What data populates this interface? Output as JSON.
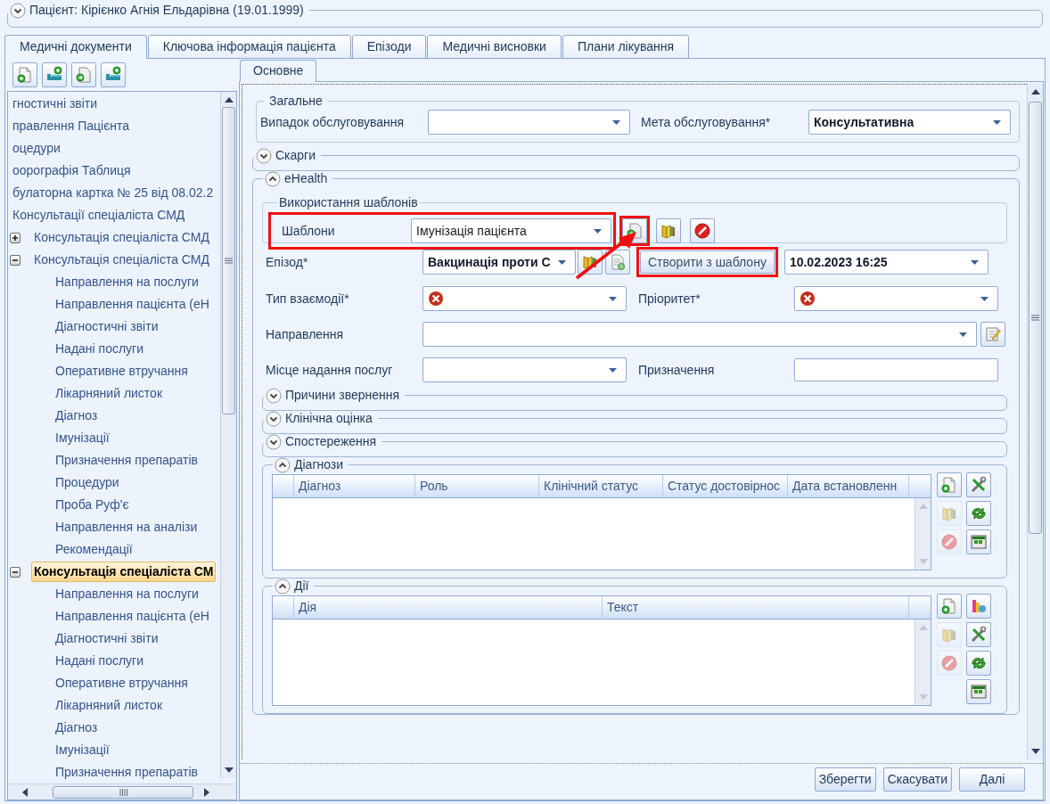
{
  "patient_header": {
    "title": "Пацієнт: Кірієнко Агнія Ельдарівна (19.01.1999)",
    "expanded": false
  },
  "tabs": [
    {
      "label": "Медичні документи",
      "selected": true
    },
    {
      "label": "Ключова інформація пацієнта",
      "selected": false
    },
    {
      "label": "Епізоди",
      "selected": false
    },
    {
      "label": "Медичні висновки",
      "selected": false
    },
    {
      "label": "Плани лікування",
      "selected": false
    }
  ],
  "left_toolbar": [
    {
      "kind": "document-add"
    },
    {
      "kind": "bed-add"
    },
    {
      "kind": "document-import"
    },
    {
      "kind": "bed-add"
    }
  ],
  "tree": [
    {
      "label": "гностичні звіти",
      "selected": false
    },
    {
      "label": "правлення Пацієнта",
      "selected": false
    },
    {
      "label": "оцедури",
      "selected": false
    },
    {
      "label": "оорографія Таблиця",
      "selected": false
    },
    {
      "label": "булаторна картка № 25 від 08.02.2",
      "selected": false
    },
    {
      "label": "Консультації спеціаліста СМД",
      "selected": false,
      "children": [
        {
          "label": "Консультація спеціаліста СМД",
          "selected": false,
          "expanded": false
        },
        {
          "label": "Консультація спеціаліста СМД",
          "selected": false,
          "expanded": true,
          "children": [
            {
              "label": "Направлення на послуги",
              "selected": false
            },
            {
              "label": "Направлення пацієнта (eH",
              "selected": false
            },
            {
              "label": "Діагностичні звіти",
              "selected": false
            },
            {
              "label": "Надані послуги",
              "selected": false
            },
            {
              "label": "Оперативне втручання",
              "selected": false
            },
            {
              "label": "Лікарняний листок",
              "selected": false
            },
            {
              "label": "Діагноз",
              "selected": false
            },
            {
              "label": "Імунізації",
              "selected": false
            },
            {
              "label": "Призначення препаратів",
              "selected": false
            },
            {
              "label": "Процедури",
              "selected": false
            },
            {
              "label": "Проба Руф'є",
              "selected": false
            },
            {
              "label": "Направлення на аналізи",
              "selected": false
            },
            {
              "label": "Рекомендації",
              "selected": false
            }
          ]
        },
        {
          "label": "Консультація спеціаліста СМ",
          "selected": true,
          "expanded": true,
          "children": [
            {
              "label": "Направлення на послуги",
              "selected": false
            },
            {
              "label": "Направлення пацієнта (eH",
              "selected": false
            },
            {
              "label": "Діагностичні звіти",
              "selected": false
            },
            {
              "label": "Надані послуги",
              "selected": false
            },
            {
              "label": "Оперативне втручання",
              "selected": false
            },
            {
              "label": "Лікарняний листок",
              "selected": false
            },
            {
              "label": "Діагноз",
              "selected": false
            },
            {
              "label": "Імунізації",
              "selected": false
            },
            {
              "label": "Призначення препаратів",
              "selected": false
            }
          ]
        }
      ]
    }
  ],
  "inner_tabs": [
    {
      "label": "Основне",
      "selected": true
    }
  ],
  "general": {
    "title": "Загальне",
    "fields": [
      {
        "label": "Випадок обслуговування"
      },
      {
        "label": "Мета обслуговування*",
        "value": "Консультативна"
      }
    ]
  },
  "complaints": {
    "title": "Скарги",
    "expanded": false
  },
  "ehealth": {
    "title": "eHealth",
    "expanded": true,
    "templates": {
      "title": "Використання шаблонів",
      "label": "Шаблони",
      "value": "Імунізація пацієнта",
      "highlighted": true,
      "buttons": [
        {
          "kind": "document-import",
          "highlighted": true
        },
        {
          "kind": "folder",
          "highlighted": false
        },
        {
          "kind": "delete",
          "highlighted": false
        }
      ]
    },
    "episode": {
      "label": "Епізод*",
      "value": "Вакцинація проти С",
      "buttons": [
        {
          "kind": "folder"
        },
        {
          "kind": "document-list"
        }
      ]
    },
    "create_button": {
      "label": "Створити з шаблону",
      "highlighted": true
    },
    "date": {
      "value": "10.02.2023 16:25"
    },
    "interaction_type": {
      "label": "Тип взаємодії*",
      "error": true
    },
    "priority": {
      "label": "Пріоритет*",
      "error": true
    },
    "referral": {
      "label": "Направлення",
      "button": {
        "kind": "edit"
      }
    },
    "place": {
      "label": "Місце надання послуг"
    },
    "assignment": {
      "label": "Призначення"
    },
    "collapsed_sections": [
      {
        "title": "Причини звернення",
        "expanded": false
      },
      {
        "title": "Клінічна оцінка",
        "expanded": false
      },
      {
        "title": "Спостереження",
        "expanded": false
      }
    ],
    "diagnoses": {
      "title": "Діагнози",
      "expanded": true,
      "columns": [
        "Діагноз",
        "Роль",
        "Клінічний статус",
        "Статус достовірнос",
        "Дата встановленн"
      ],
      "buttons": [
        {
          "kind": "document-add",
          "disabled": false
        },
        {
          "kind": "tools",
          "disabled": false
        },
        {
          "kind": "folder",
          "disabled": true
        },
        {
          "kind": "refresh",
          "disabled": false
        },
        {
          "kind": "delete",
          "disabled": true
        },
        {
          "kind": "grid",
          "disabled": false
        }
      ]
    },
    "actions": {
      "title": "Дії",
      "expanded": true,
      "columns": [
        "Дія",
        "Текст"
      ],
      "buttons": [
        {
          "kind": "document-add",
          "disabled": false
        },
        {
          "kind": "chart",
          "disabled": false
        },
        {
          "kind": "folder",
          "disabled": true
        },
        {
          "kind": "tools",
          "disabled": false
        },
        {
          "kind": "delete",
          "disabled": true
        },
        {
          "kind": "refresh",
          "disabled": false
        },
        {
          "kind": "grid",
          "disabled": false
        }
      ]
    }
  },
  "footer_buttons": [
    "Зберегти",
    "Скасувати",
    "Далі"
  ]
}
